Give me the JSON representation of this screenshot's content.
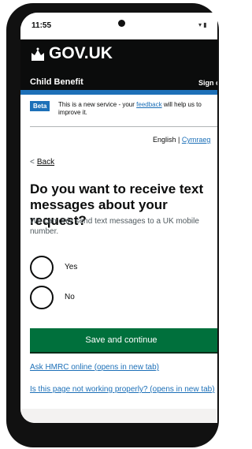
{
  "status_bar": {
    "time": "11:55",
    "icons": "▾ ▮"
  },
  "header": {
    "brand": "GOV.UK",
    "service_name": "Child Benefit",
    "sign_out": "Sign out"
  },
  "phase_banner": {
    "tag": "Beta",
    "text_before": "This is a new service - your ",
    "feedback_link": "feedback",
    "text_after": " will help us to improve it."
  },
  "language": {
    "english": "English",
    "separator": " | ",
    "cymraeg": "Cymraeg"
  },
  "back_link": {
    "chevron": "<",
    "label": "Back"
  },
  "question": {
    "heading": "Do you want to receive text messages about your request?",
    "hint": "We can only send text messages to a UK mobile number.",
    "options": [
      "Yes",
      "No"
    ]
  },
  "submit": {
    "label": "Save and continue"
  },
  "help_links": {
    "ask_hmrc": "Ask HMRC online (opens in new tab)",
    "not_working": "Is this page not working properly? (opens in new tab)"
  },
  "colors": {
    "header_bg": "#0b0c0c",
    "blue": "#1d70b8",
    "button_green": "#00703c"
  }
}
